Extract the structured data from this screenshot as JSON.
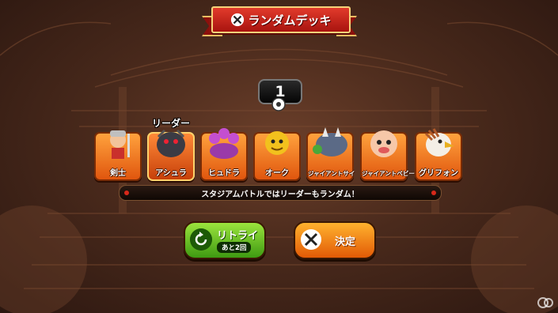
{
  "header": {
    "title": "ランダムデッキ",
    "icon": "crossed-swords-icon"
  },
  "deck_counter": {
    "value": "1",
    "icon": "gear-icon"
  },
  "leader_label": "リーダー",
  "monsters": [
    {
      "name": "剣士",
      "icon": "swordsman-icon",
      "leader": false
    },
    {
      "name": "アシュラ",
      "icon": "ashura-icon",
      "leader": true
    },
    {
      "name": "ヒュドラ",
      "icon": "hydra-icon",
      "leader": false
    },
    {
      "name": "オーク",
      "icon": "orc-icon",
      "leader": false
    },
    {
      "name": "ジャイアントサイ",
      "icon": "giant-rhino-icon",
      "leader": false
    },
    {
      "name": "ジャイアントベビー",
      "icon": "giant-baby-icon",
      "leader": false
    },
    {
      "name": "グリフォン",
      "icon": "griffon-icon",
      "leader": false
    }
  ],
  "info_text": "スタジアムバトルではリーダーもランダム！",
  "buttons": {
    "retry": {
      "label": "リトライ",
      "sub": "あと2回",
      "icon": "retry-icon"
    },
    "confirm": {
      "label": "決定",
      "icon": "crossed-swords-icon"
    }
  },
  "colors": {
    "retry": "#5cbf1e",
    "confirm": "#f08a14",
    "card": "#f07a22",
    "ribbon": "#c71d14"
  }
}
